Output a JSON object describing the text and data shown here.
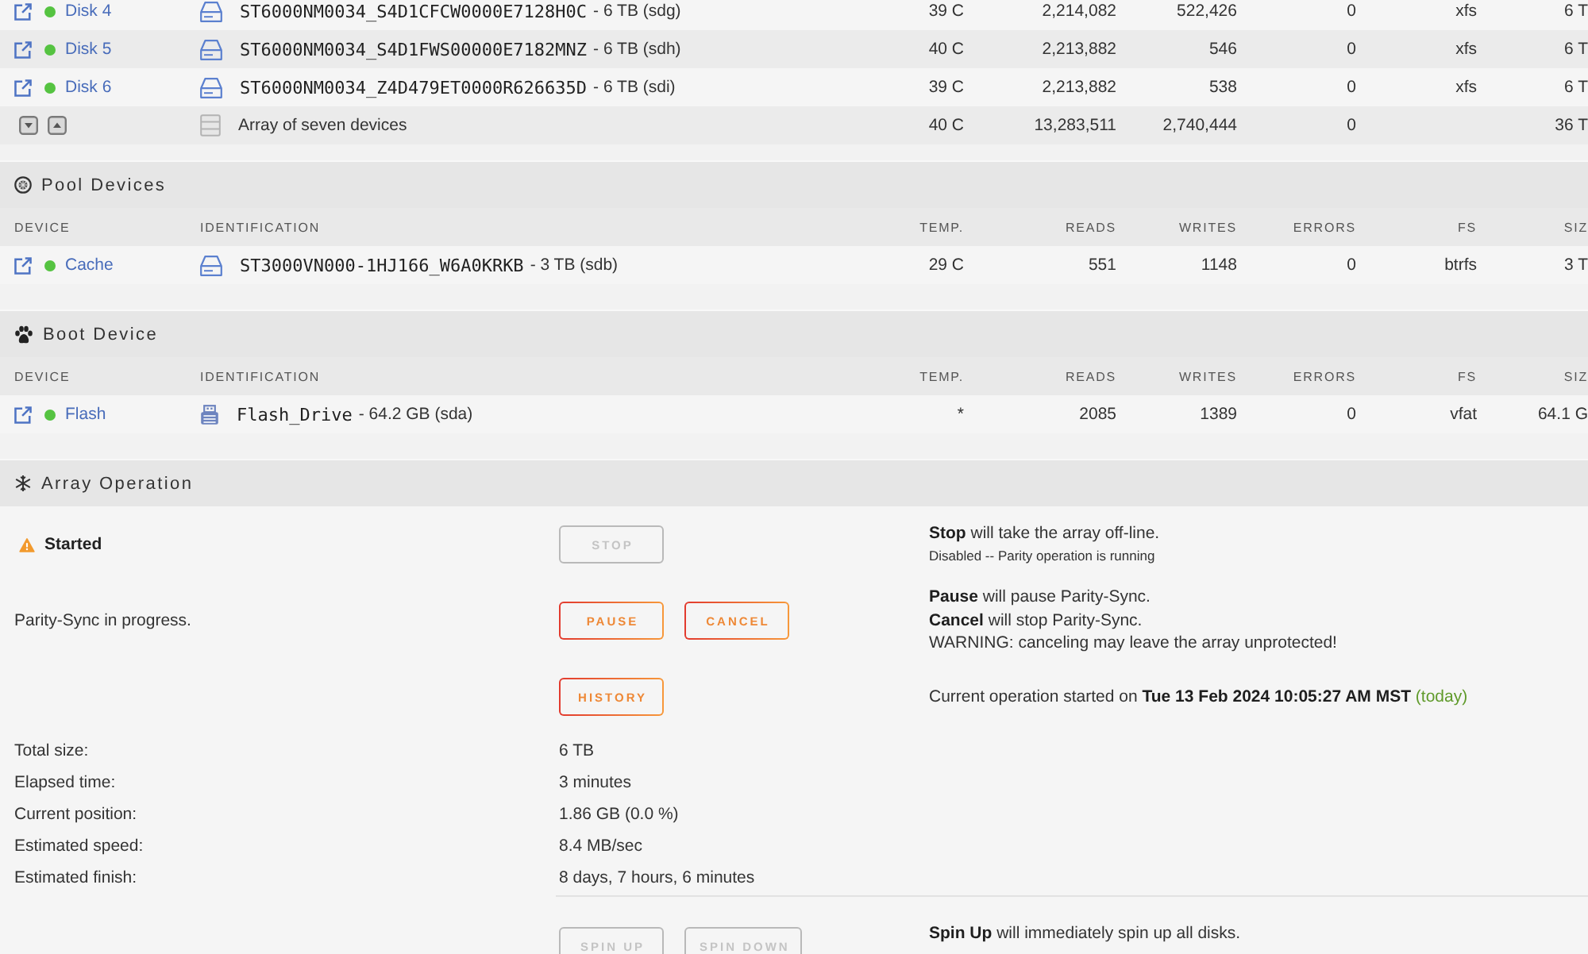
{
  "array_devices": {
    "rows": [
      {
        "kind": "disk",
        "name": "Disk 4",
        "color": "#55c341",
        "model": "ST6000NM0034_S4D1CFCW0000E7128H0C",
        "capacity": "- 6 TB (sdg)",
        "temp": "39 C",
        "reads": "2,214,082",
        "writes": "522,426",
        "errors": "0",
        "fs": "xfs",
        "size": "6 T"
      },
      {
        "kind": "disk",
        "name": "Disk 5",
        "color": "#55c341",
        "model": "ST6000NM0034_S4D1FWS00000E7182MNZ",
        "capacity": "- 6 TB (sdh)",
        "temp": "40 C",
        "reads": "2,213,882",
        "writes": "546",
        "errors": "0",
        "fs": "xfs",
        "size": "6 T"
      },
      {
        "kind": "disk",
        "name": "Disk 6",
        "color": "#55c341",
        "model": "ST6000NM0034_Z4D479ET0000R626635D",
        "capacity": "- 6 TB (sdi)",
        "temp": "39 C",
        "reads": "2,213,882",
        "writes": "538",
        "errors": "0",
        "fs": "xfs",
        "size": "6 T"
      },
      {
        "kind": "summary",
        "description": "Array of seven devices",
        "temp": "40 C",
        "reads": "13,283,511",
        "writes": "2,740,444",
        "errors": "0",
        "size": "36 T"
      }
    ]
  },
  "pool_devices": {
    "title": "Pool Devices",
    "columns": [
      "DEVICE",
      "IDENTIFICATION",
      "TEMP.",
      "READS",
      "WRITES",
      "ERRORS",
      "FS",
      "SIZ"
    ],
    "rows": [
      {
        "kind": "disk",
        "name": "Cache",
        "color": "#55c341",
        "model": "ST3000VN000-1HJ166_W6A0KRKB",
        "capacity": "- 3 TB (sdb)",
        "temp": "29 C",
        "reads": "551",
        "writes": "1148",
        "errors": "0",
        "fs": "btrfs",
        "size": "3 T"
      }
    ]
  },
  "boot_device": {
    "title": "Boot Device",
    "columns": [
      "DEVICE",
      "IDENTIFICATION",
      "TEMP.",
      "READS",
      "WRITES",
      "ERRORS",
      "FS",
      "SIZ"
    ],
    "rows": [
      {
        "kind": "flash",
        "name": "Flash",
        "color": "#55c341",
        "model": "Flash_Drive",
        "capacity": "- 64.2 GB (sda)",
        "temp": "*",
        "reads": "2085",
        "writes": "1389",
        "errors": "0",
        "fs": "vfat",
        "size": "64.1 G"
      }
    ]
  },
  "array_operation": {
    "title": "Array Operation",
    "controls": [
      {
        "kind": "status",
        "label": "Started",
        "buttons": [
          {
            "label": "STOP",
            "disabled": true
          }
        ],
        "notes": [
          {
            "kind": "text",
            "text": "**Stop** will take the array off-line."
          },
          {
            "kind": "small",
            "text": "Disabled -- Parity operation is running"
          }
        ]
      },
      {
        "kind": "text",
        "label": "Parity-Sync in progress.",
        "buttons": [
          {
            "label": "PAUSE",
            "disabled": false
          },
          {
            "label": "CANCEL",
            "disabled": false
          }
        ],
        "notes": [
          {
            "kind": "text",
            "text": "**Pause** will pause Parity-Sync."
          },
          {
            "kind": "text",
            "text": "**Cancel** will stop Parity-Sync."
          },
          {
            "kind": "text",
            "text": "WARNING: canceling may leave the array unprotected!"
          }
        ]
      },
      {
        "buttons": [
          {
            "label": "HISTORY",
            "disabled": false
          }
        ],
        "notes": [
          {
            "kind": "text",
            "text": "Current operation started on **Tue 13 Feb 2024 10:05:27 AM MST**",
            "tag": "(today)"
          }
        ]
      }
    ],
    "stats": [
      {
        "label": "Total size:",
        "value": "6 TB"
      },
      {
        "label": "Elapsed time:",
        "value": "3 minutes"
      },
      {
        "label": "Current position:",
        "value": "1.86 GB (0.0 %)"
      },
      {
        "label": "Estimated speed:",
        "value": "8.4 MB/sec"
      },
      {
        "label": "Estimated finish:",
        "value": "8 days, 7 hours, 6 minutes"
      }
    ],
    "spin": {
      "buttons": [
        {
          "label": "SPIN UP",
          "disabled": true
        },
        {
          "label": "SPIN DOWN",
          "disabled": true
        }
      ],
      "notes": [
        {
          "kind": "text",
          "text": "**Spin Up** will immediately spin up all disks."
        }
      ]
    }
  }
}
